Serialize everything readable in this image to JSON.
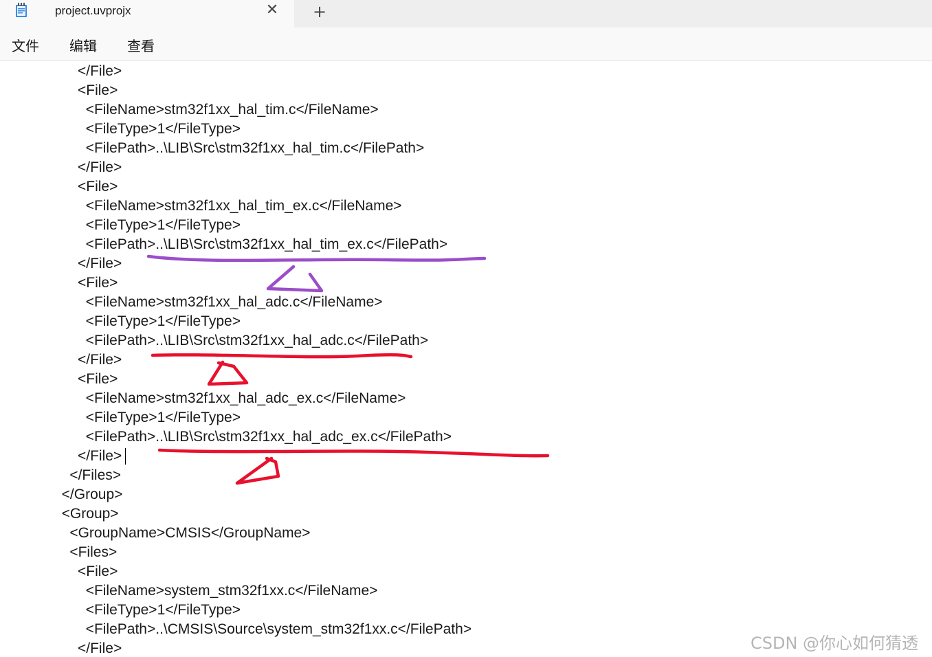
{
  "window": {
    "tab_title": "project.uvprojx",
    "tab_close_glyph": "✕",
    "new_tab_glyph": "+",
    "app_icon": "notepad-icon"
  },
  "menu": {
    "items": [
      "文件",
      "编辑",
      "查看"
    ]
  },
  "editor": {
    "lines": [
      "      </File>",
      "      <File>",
      "        <FileName>stm32f1xx_hal_tim.c</FileName>",
      "        <FileType>1</FileType>",
      "        <FilePath>..\\LIB\\Src\\stm32f1xx_hal_tim.c</FilePath>",
      "      </File>",
      "      <File>",
      "        <FileName>stm32f1xx_hal_tim_ex.c</FileName>",
      "        <FileType>1</FileType>",
      "        <FilePath>..\\LIB\\Src\\stm32f1xx_hal_tim_ex.c</FilePath>",
      "      </File>",
      "      <File>",
      "        <FileName>stm32f1xx_hal_adc.c</FileName>",
      "        <FileType>1</FileType>",
      "        <FilePath>..\\LIB\\Src\\stm32f1xx_hal_adc.c</FilePath>",
      "      </File>",
      "      <File>",
      "        <FileName>stm32f1xx_hal_adc_ex.c</FileName>",
      "        <FileType>1</FileType>",
      "        <FilePath>..\\LIB\\Src\\stm32f1xx_hal_adc_ex.c</FilePath>",
      "      </File>",
      "    </Files>",
      "  </Group>",
      "  <Group>",
      "    <GroupName>CMSIS</GroupName>",
      "    <Files>",
      "      <File>",
      "        <FileName>system_stm32f1xx.c</FileName>",
      "        <FileType>1</FileType>",
      "        <FilePath>..\\CMSIS\\Source\\system_stm32f1xx.c</FilePath>",
      "      </File>"
    ],
    "caret_line": 20
  },
  "annotations": {
    "colors": {
      "purple": "#9b4dca",
      "red": "#e8112d"
    }
  },
  "watermark": "CSDN @你心如何猜透"
}
